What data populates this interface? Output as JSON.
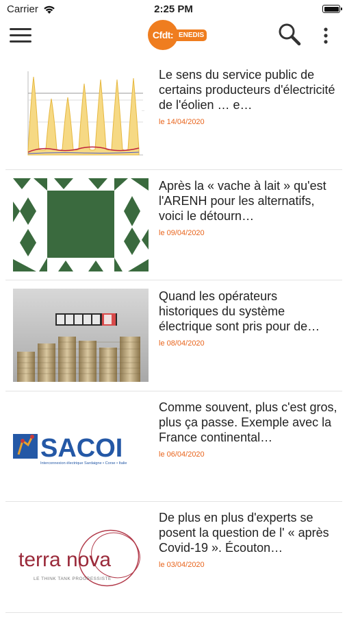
{
  "status_bar": {
    "carrier": "Carrier",
    "time": "2:25 PM"
  },
  "nav": {
    "menu_icon": "hamburger-menu-icon",
    "logo_text": "Cfdt:",
    "logo_sub": "ENEDIS",
    "search_icon": "search-icon",
    "more_icon": "more-vertical-icon"
  },
  "articles": [
    {
      "title": "Le sens du service public de certains producteurs d'électricité de l'éolien … e…",
      "date": "le 14/04/2020",
      "thumbnail": "chart-graph-image"
    },
    {
      "title": "Après la « vache à lait » qu'est l'ARENH pour les alternatifs, voici le détourn…",
      "date": "le 09/04/2020",
      "thumbnail": "green-pattern-image"
    },
    {
      "title": "Quand les opérateurs historiques du système électrique sont pris pour de…",
      "date": "le 08/04/2020",
      "thumbnail": "coins-meter-image"
    },
    {
      "title": "Comme souvent, plus c'est gros, plus ça passe. Exemple avec la France continental…",
      "date": "le 06/04/2020",
      "thumbnail": "sacoi-logo-image",
      "thumb_text": "SACOI",
      "thumb_caption": "Interconnexion électrique Sardaigne • Corse • Italie"
    },
    {
      "title": "De plus en plus d'experts se posent la question de l' « après Covid-19 ». Écouton…",
      "date": "le 03/04/2020",
      "thumbnail": "terranova-logo-image",
      "thumb_text": "terra nova",
      "thumb_caption": "LE THINK TANK PROGRESSISTE"
    }
  ]
}
